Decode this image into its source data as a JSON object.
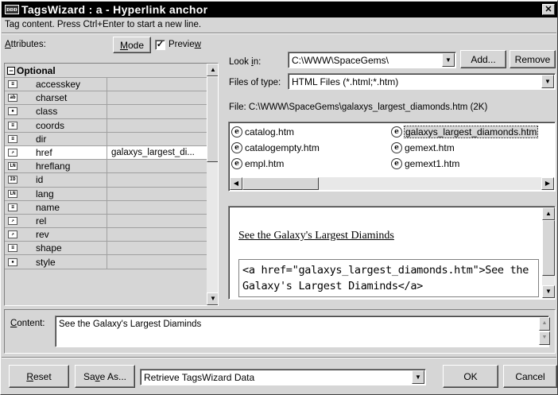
{
  "window": {
    "icon_text": "ᴅᴅᴅ",
    "title": "TagsWizard : a - Hyperlink anchor",
    "close_label": "✕"
  },
  "hint": "Tag content. Press Ctrl+Enter to start a new line.",
  "attributes": {
    "label": "Attributes:",
    "label_accel": "A",
    "label_rest": "ttributes:",
    "mode_button": "Mode",
    "mode_accel": "M",
    "mode_rest": "ode",
    "preview_label": "Preview",
    "preview_main": "Previe",
    "preview_accel": "w",
    "preview_checked": true,
    "check_mark": "✓",
    "group_title": "Optional",
    "rows": [
      {
        "icon": "≡",
        "name": "accesskey",
        "value": ""
      },
      {
        "icon": "ab",
        "name": "charset",
        "value": ""
      },
      {
        "icon": "▪",
        "name": "class",
        "value": ""
      },
      {
        "icon": "≡",
        "name": "coords",
        "value": ""
      },
      {
        "icon": "≡",
        "name": "dir",
        "value": ""
      },
      {
        "icon": "↗",
        "name": "href",
        "value": "galaxys_largest_di..."
      },
      {
        "icon": "LN",
        "name": "hreflang",
        "value": ""
      },
      {
        "icon": "ID",
        "name": "id",
        "value": ""
      },
      {
        "icon": "LN",
        "name": "lang",
        "value": ""
      },
      {
        "icon": "≡",
        "name": "name",
        "value": ""
      },
      {
        "icon": "↗",
        "name": "rel",
        "value": ""
      },
      {
        "icon": "↗",
        "name": "rev",
        "value": ""
      },
      {
        "icon": "≡",
        "name": "shape",
        "value": ""
      },
      {
        "icon": "▪",
        "name": "style",
        "value": ""
      }
    ]
  },
  "browser": {
    "look_in_label": "Look in:",
    "look_in_value": "C:\\WWW\\SpaceGems\\",
    "add_button": "Add...",
    "remove_button": "Remove",
    "files_type_label": "Files of type:",
    "files_type_value": "HTML Files (*.html;*.htm)",
    "file_info": "File: C:\\WWW\\SpaceGems\\galaxys_largest_diamonds.htm (2K)",
    "files": [
      {
        "name": "catalog.htm",
        "selected": false
      },
      {
        "name": "catalogempty.htm",
        "selected": false
      },
      {
        "name": "empl.htm",
        "selected": false
      },
      {
        "name": "galaxys_largest_diamonds.htm",
        "selected": true
      },
      {
        "name": "gemext.htm",
        "selected": false
      },
      {
        "name": "gemext1.htm",
        "selected": false
      }
    ]
  },
  "preview": {
    "link_text": "See the Galaxy's Largest Diaminds",
    "code_text": "<a href=\"galaxys_largest_diamonds.htm\">See the Galaxy's Largest Diaminds</a>"
  },
  "content": {
    "label": "Content:",
    "value": "See the Galaxy's Largest Diaminds"
  },
  "footer": {
    "reset_button": "Reset",
    "save_as_button": "Save As...",
    "action_select": "Retrieve TagsWizard Data",
    "ok_button": "OK",
    "cancel_button": "Cancel"
  },
  "glyphs": {
    "up": "▲",
    "down": "▼",
    "left": "◀",
    "right": "▶",
    "minus": "−",
    "file_icon": "e"
  }
}
